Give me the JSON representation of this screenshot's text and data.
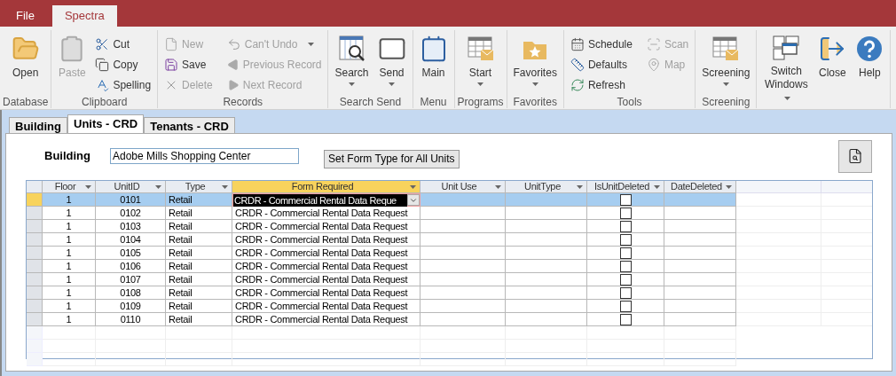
{
  "ribbon": {
    "tabs": [
      {
        "label": "File",
        "selected": false
      },
      {
        "label": "Spectra",
        "selected": true
      }
    ],
    "groups": [
      {
        "label": "Database",
        "items": [
          {
            "kind": "large",
            "label": "Open",
            "disabled": false,
            "dropdown": false
          }
        ]
      },
      {
        "label": "Clipboard",
        "items": [
          {
            "kind": "large",
            "label": "Paste",
            "disabled": true,
            "dropdown": false
          },
          {
            "kind": "small",
            "label": "Cut",
            "disabled": false,
            "dropdown": false
          },
          {
            "kind": "small",
            "label": "Copy",
            "disabled": false,
            "dropdown": false
          },
          {
            "kind": "small",
            "label": "Spelling",
            "disabled": false,
            "dropdown": false
          }
        ]
      },
      {
        "label": "Records",
        "items": [
          {
            "kind": "small",
            "label": "New",
            "disabled": true,
            "dropdown": false
          },
          {
            "kind": "small",
            "label": "Save",
            "disabled": false,
            "dropdown": false
          },
          {
            "kind": "small",
            "label": "Delete",
            "disabled": true,
            "dropdown": false
          },
          {
            "kind": "small",
            "label": "Can't Undo",
            "disabled": true,
            "dropdown": true
          },
          {
            "kind": "small",
            "label": "Previous Record",
            "disabled": true,
            "dropdown": false
          },
          {
            "kind": "small",
            "label": "Next Record",
            "disabled": true,
            "dropdown": false
          }
        ]
      },
      {
        "label": "Search Send",
        "items": [
          {
            "kind": "large",
            "label": "Search",
            "disabled": false,
            "dropdown": true
          },
          {
            "kind": "large",
            "label": "Send",
            "disabled": false,
            "dropdown": true
          }
        ]
      },
      {
        "label": "Menu",
        "items": [
          {
            "kind": "large",
            "label": "Main",
            "disabled": false,
            "dropdown": false
          }
        ]
      },
      {
        "label": "Programs",
        "items": [
          {
            "kind": "large",
            "label": "Start",
            "disabled": false,
            "dropdown": true
          }
        ]
      },
      {
        "label": "Favorites",
        "items": [
          {
            "kind": "large",
            "label": "Favorites",
            "disabled": false,
            "dropdown": true
          }
        ]
      },
      {
        "label": "Tools",
        "items": [
          {
            "kind": "small",
            "label": "Schedule",
            "disabled": false,
            "dropdown": false
          },
          {
            "kind": "small",
            "label": "Defaults",
            "disabled": false,
            "dropdown": false
          },
          {
            "kind": "small",
            "label": "Refresh",
            "disabled": false,
            "dropdown": false
          },
          {
            "kind": "small",
            "label": "Scan",
            "disabled": true,
            "dropdown": false
          },
          {
            "kind": "small",
            "label": "Map",
            "disabled": true,
            "dropdown": false
          }
        ]
      },
      {
        "label": "Screening",
        "items": [
          {
            "kind": "large",
            "label": "Screening",
            "disabled": false,
            "dropdown": true
          }
        ]
      },
      {
        "items": [
          {
            "kind": "large",
            "label": "Switch Windows",
            "disabled": false,
            "dropdown": true
          },
          {
            "kind": "large",
            "label": "Close",
            "disabled": false,
            "dropdown": false
          },
          {
            "kind": "large",
            "label": "Help",
            "disabled": false,
            "dropdown": false
          }
        ]
      }
    ]
  },
  "form_tabs": [
    {
      "label": "Building",
      "selected": false
    },
    {
      "label": "Units - CRD",
      "selected": true
    },
    {
      "label": "Tenants - CRD",
      "selected": false
    }
  ],
  "building": {
    "label": "Building",
    "value": "Adobe Mills Shopping Center"
  },
  "set_form_button": "Set Form Type for All Units",
  "grid": {
    "columns": [
      {
        "label": "Floor",
        "selected": false
      },
      {
        "label": "UnitID",
        "selected": false
      },
      {
        "label": "Type",
        "selected": false
      },
      {
        "label": "Form Required",
        "selected": true
      },
      {
        "label": "Unit Use",
        "selected": false
      },
      {
        "label": "UnitType",
        "selected": false
      },
      {
        "label": "IsUnitDeleted",
        "selected": false
      },
      {
        "label": "DateDeleted",
        "selected": false
      }
    ],
    "rows": [
      {
        "selected": true,
        "editing": true,
        "floor": "1",
        "unit_id": "0101",
        "type": "Retail",
        "form_required": "CRDR - Commercial Rental Data Reque",
        "is_unit_deleted": false
      },
      {
        "selected": false,
        "editing": false,
        "floor": "1",
        "unit_id": "0102",
        "type": "Retail",
        "form_required": "CRDR - Commercial Rental Data Request",
        "is_unit_deleted": false
      },
      {
        "selected": false,
        "editing": false,
        "floor": "1",
        "unit_id": "0103",
        "type": "Retail",
        "form_required": "CRDR - Commercial Rental Data Request",
        "is_unit_deleted": false
      },
      {
        "selected": false,
        "editing": false,
        "floor": "1",
        "unit_id": "0104",
        "type": "Retail",
        "form_required": "CRDR - Commercial Rental Data Request",
        "is_unit_deleted": false
      },
      {
        "selected": false,
        "editing": false,
        "floor": "1",
        "unit_id": "0105",
        "type": "Retail",
        "form_required": "CRDR - Commercial Rental Data Request",
        "is_unit_deleted": false
      },
      {
        "selected": false,
        "editing": false,
        "floor": "1",
        "unit_id": "0106",
        "type": "Retail",
        "form_required": "CRDR - Commercial Rental Data Request",
        "is_unit_deleted": false
      },
      {
        "selected": false,
        "editing": false,
        "floor": "1",
        "unit_id": "0107",
        "type": "Retail",
        "form_required": "CRDR - Commercial Rental Data Request",
        "is_unit_deleted": false
      },
      {
        "selected": false,
        "editing": false,
        "floor": "1",
        "unit_id": "0108",
        "type": "Retail",
        "form_required": "CRDR - Commercial Rental Data Request",
        "is_unit_deleted": false
      },
      {
        "selected": false,
        "editing": false,
        "floor": "1",
        "unit_id": "0109",
        "type": "Retail",
        "form_required": "CRDR - Commercial Rental Data Request",
        "is_unit_deleted": false
      },
      {
        "selected": false,
        "editing": false,
        "floor": "1",
        "unit_id": "0110",
        "type": "Retail",
        "form_required": "CRDR - Commercial Rental Data Request",
        "is_unit_deleted": false
      }
    ]
  }
}
